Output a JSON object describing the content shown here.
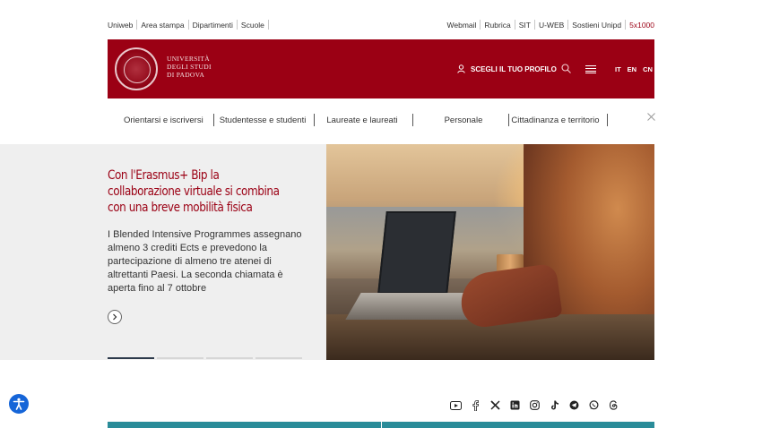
{
  "top_links_left": [
    "Uniweb",
    "Area stampa",
    "Dipartimenti",
    "Scuole"
  ],
  "top_links_right": [
    "Webmail",
    "Rubrica",
    "SIT",
    "U-WEB",
    "Sostieni Unipd",
    "5x1000"
  ],
  "header": {
    "uni_name_line1": "UNIVERSITÀ",
    "uni_name_line2": "DEGLI STUDI",
    "uni_name_line3": "DI PADOVA",
    "profile_label": "SCEGLI IL TUO PROFILO",
    "languages": [
      "IT",
      "EN",
      "CN"
    ]
  },
  "nav": [
    "Orientarsi e iscriversi",
    "Studentesse e studenti",
    "Laureate e laureati",
    "Personale",
    "Cittadinanza e territorio"
  ],
  "hero": {
    "title": "Con l'Erasmus+ Bip la collaborazione virtuale si combina con una breve mobilità fisica",
    "body": "I Blended Intensive Programmes assegnano almeno 3 crediti Ects e prevedono la partecipazione di almeno tre atenei di altrettanti Paesi. La seconda chiamata è aperta fino al 7 ottobre",
    "slide_count": 4,
    "active_slide": 1
  },
  "social_icons": [
    "youtube-icon",
    "facebook-icon",
    "x-icon",
    "linkedin-icon",
    "instagram-icon",
    "tiktok-icon",
    "telegram-icon",
    "whatsapp-icon",
    "threads-icon"
  ],
  "colors": {
    "brand": "#9b0014",
    "accent_link": "#9b0014",
    "accessibility": "#1565d8",
    "footer_band": "#2a8c99"
  }
}
